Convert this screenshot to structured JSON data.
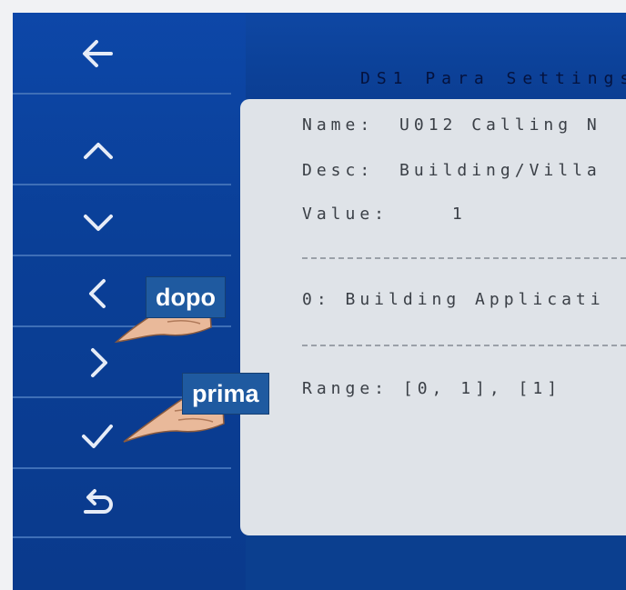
{
  "screen": {
    "title": "DS1 Para Settings",
    "name_label": "Name:",
    "name_value": "U012 Calling N",
    "desc_label": "Desc:",
    "desc_value": "Building/Villa",
    "value_label": "Value:",
    "value_value": "1",
    "option_text": "0: Building Applicati",
    "range_text": "Range: [0, 1], [1]"
  },
  "nav": {
    "back_icon": "arrow-left-icon",
    "up_icon": "chevron-up-icon",
    "down_icon": "chevron-down-icon",
    "left_icon": "chevron-left-icon",
    "right_icon": "chevron-right-icon",
    "confirm_icon": "checkmark-icon",
    "return_icon": "return-arrow-icon"
  },
  "annotations": {
    "label_dopo": "dopo",
    "label_prima": "prima"
  },
  "colors": {
    "sidebar": "#0b3f8f",
    "panel": "#dfe3e8",
    "tag": "#1f5aa0"
  }
}
